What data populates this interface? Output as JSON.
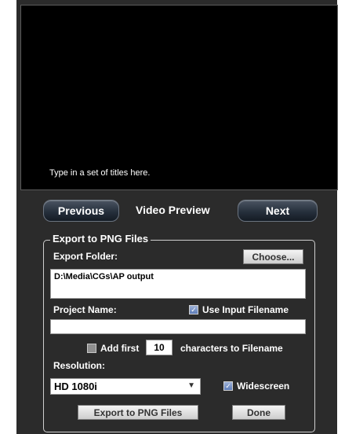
{
  "preview": {
    "text": "Type in a set of titles here."
  },
  "nav": {
    "previous_label": "Previous",
    "preview_label": "Video Preview",
    "next_label": "Next"
  },
  "export": {
    "group_title": "Export to PNG Files",
    "folder_label": "Export Folder:",
    "choose_label": "Choose...",
    "folder_value": "D:\\Media\\CGs\\AP output",
    "project_label": "Project Name:",
    "use_input_filename_label": "Use Input Filename",
    "use_input_filename_checked": true,
    "project_value": "",
    "add_first_label": "Add first",
    "add_first_checked": false,
    "char_count": "10",
    "characters_label": "characters to Filename",
    "resolution_label": "Resolution:",
    "resolution_value": "HD 1080i",
    "widescreen_label": "Widescreen",
    "widescreen_checked": true,
    "export_button_label": "Export to PNG Files",
    "done_button_label": "Done"
  },
  "colors": {
    "window_bg": "#2b2b2b",
    "preview_bg": "#000000",
    "nav_button": "#26303c",
    "check_accent": "#5c7cb8"
  },
  "icons": {
    "checkbox_checked": "checkmark",
    "dropdown": "chevron-down"
  }
}
